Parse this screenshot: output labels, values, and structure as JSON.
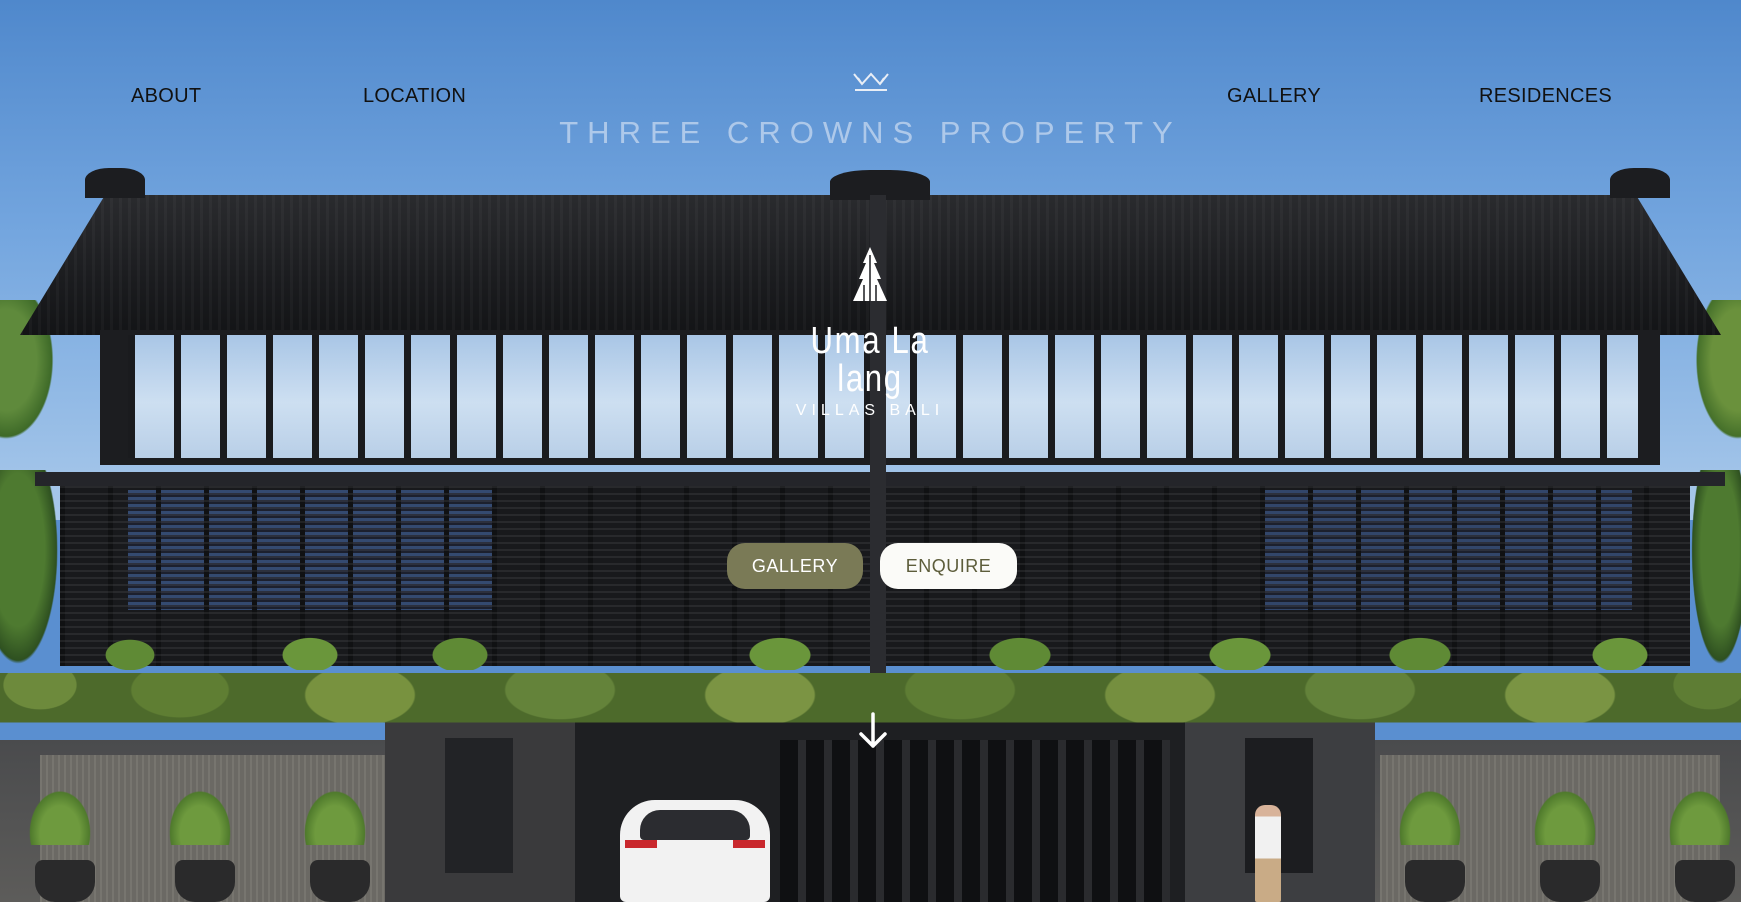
{
  "nav": {
    "about": "ABOUT",
    "location": "LOCATION",
    "gallery": "GALLERY",
    "residences": "RESIDENCES"
  },
  "brand": {
    "name": "THREE CROWNS PROPERTY",
    "icon": "crown-icon"
  },
  "hero": {
    "logo_name": "Uma La lang",
    "logo_sub": "VILLAS BALI",
    "logo_icon": "pagoda-icon",
    "gallery_button": "GALLERY",
    "enquire_button": "ENQUIRE",
    "scroll_icon": "arrow-down-icon"
  },
  "colors": {
    "gallery_button_bg": "#7a7a56",
    "enquire_button_bg": "#fbfbf8",
    "enquire_text": "#5d5d3b",
    "nav_text": "#111111"
  }
}
